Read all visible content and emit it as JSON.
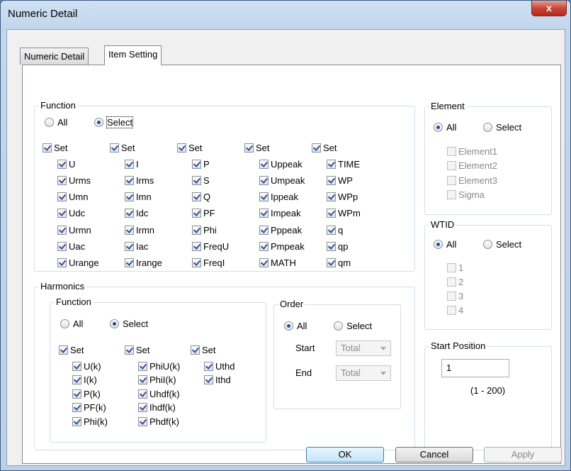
{
  "window": {
    "title": "Numeric Detail",
    "close_glyph": "x"
  },
  "tabs": [
    "Numeric Detail",
    "Item Setting"
  ],
  "function_group": {
    "title": "Function",
    "all_label": "All",
    "select_label": "Select",
    "set_label": "Set",
    "columns": [
      [
        "U",
        "Urms",
        "Umn",
        "Udc",
        "Urmn",
        "Uac",
        "Urange"
      ],
      [
        "I",
        "Irms",
        "Imn",
        "Idc",
        "Irmn",
        "Iac",
        "Irange"
      ],
      [
        "P",
        "S",
        "Q",
        "PF",
        "Phi",
        "FreqU",
        "FreqI"
      ],
      [
        "Uppeak",
        "Umpeak",
        "Ippeak",
        "Impeak",
        "Pppeak",
        "Pmpeak",
        "MATH"
      ],
      [
        "TIME",
        "WP",
        "WPp",
        "WPm",
        "q",
        "qp",
        "qm"
      ]
    ]
  },
  "harmonics": {
    "title": "Harmonics",
    "function_title": "Function",
    "all_label": "All",
    "select_label": "Select",
    "set_label": "Set",
    "columns": [
      [
        "U(k)",
        "I(k)",
        "P(k)",
        "PF(k)",
        "Phi(k)"
      ],
      [
        "PhiU(k)",
        "PhiI(k)",
        "Uhdf(k)",
        "Ihdf(k)",
        "Phdf(k)"
      ],
      [
        "Uthd",
        "Ithd"
      ]
    ],
    "order": {
      "title": "Order",
      "all_label": "All",
      "select_label": "Select",
      "start_label": "Start",
      "start_value": "Total",
      "end_label": "End",
      "end_value": "Total"
    }
  },
  "element": {
    "title": "Element",
    "all_label": "All",
    "select_label": "Select",
    "items": [
      "Element1",
      "Element2",
      "Element3",
      "Sigma"
    ]
  },
  "wtid": {
    "title": "WTID",
    "all_label": "All",
    "select_label": "Select",
    "items": [
      "1",
      "2",
      "3",
      "4"
    ]
  },
  "start_position": {
    "title": "Start Position",
    "value": "1",
    "range": "(1 - 200)"
  },
  "buttons": {
    "ok": "OK",
    "cancel": "Cancel",
    "apply": "Apply"
  }
}
